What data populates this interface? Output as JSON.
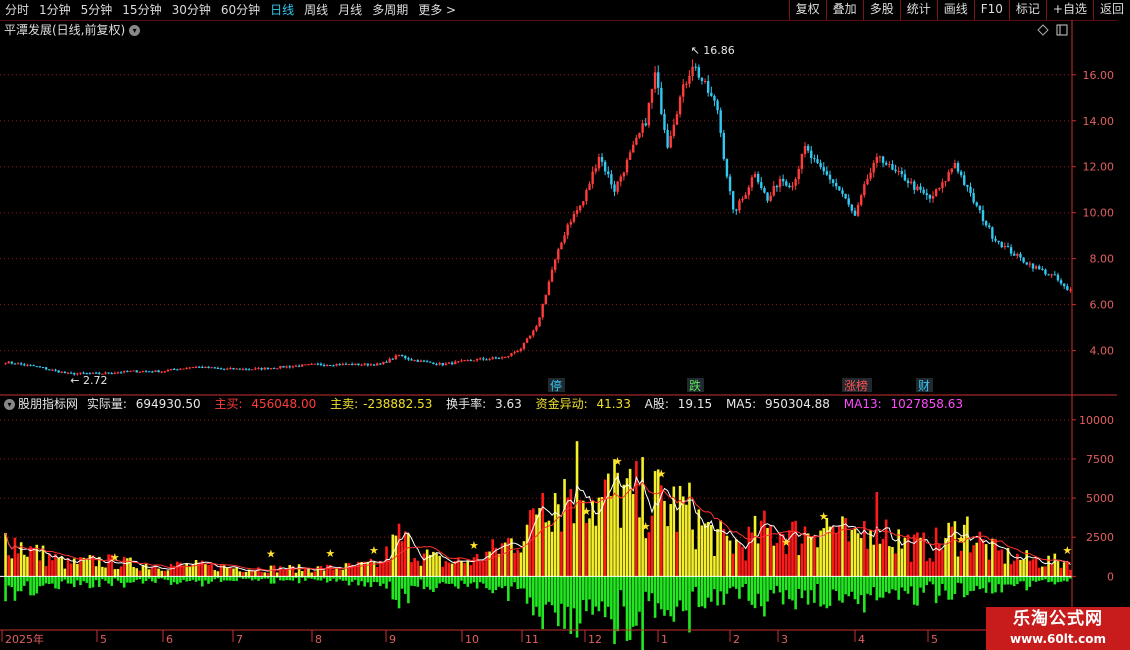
{
  "toolbar": {
    "periods": [
      "分时",
      "1分钟",
      "5分钟",
      "15分钟",
      "30分钟",
      "60分钟",
      "日线",
      "周线",
      "月线",
      "多周期",
      "更多"
    ],
    "active_period": "日线",
    "buttons": [
      "复权",
      "叠加",
      "多股",
      "统计",
      "画线",
      "F10",
      "标记",
      "+自选",
      "返回"
    ]
  },
  "chart_title": "平潭发展(日线,前复权)",
  "price_axis": {
    "ticks": [
      "16.00",
      "14.00",
      "12.00",
      "10.00",
      "8.00",
      "6.00",
      "4.00"
    ],
    "min": 2.2,
    "max": 17.6
  },
  "price_annotations": {
    "high": "16.86",
    "low": "2.72"
  },
  "event_labels": [
    {
      "text": "停",
      "color": "#33c8f0"
    },
    {
      "text": "跌",
      "color": "#5ce05c"
    },
    {
      "text": "涨榜",
      "color": "#ff5050"
    },
    {
      "text": "财",
      "color": "#33c8f0"
    }
  ],
  "indicator": {
    "name": "股朋指标网",
    "actual_label": "实际量:",
    "actual_value": "694930.50",
    "main_buy_label": "主买:",
    "main_buy_value": "456048.00",
    "main_sell_label": "主卖:",
    "main_sell_value": "-238882.53",
    "turnover_label": "换手率:",
    "turnover_value": "3.63",
    "fund_label": "资金异动:",
    "fund_value": "41.33",
    "ashare_label": "A股:",
    "ashare_value": "19.15",
    "ma5_label": "MA5:",
    "ma5_value": "950304.88",
    "ma13_label": "MA13:",
    "ma13_value": "1027858.63"
  },
  "volume_axis": {
    "ticks": [
      "10000",
      "7500",
      "5000",
      "2500",
      "0"
    ],
    "min": -3300,
    "max": 10500
  },
  "date_axis": {
    "ticks": [
      "2025年",
      "5",
      "6",
      "7",
      "8",
      "9",
      "10",
      "11",
      "12",
      "1",
      "2",
      "3",
      "4",
      "5"
    ]
  },
  "watermark": {
    "line1": "乐淘公式网",
    "line2": "www.60lt.com"
  },
  "colors": {
    "up": "#ff3c3c",
    "down": "#33c8f0",
    "grid": "#8b1a1a",
    "axis": "#c83030",
    "vol_yellow": "#f5f02a",
    "vol_red": "#ff1a1a",
    "vol_green": "#22e822",
    "ma_white": "#ffffff",
    "ma_red": "#ff3030",
    "star": "#ffe030"
  },
  "chart_data": {
    "type": "candlestick",
    "price_ylim": [
      2.2,
      17.6
    ],
    "volume_ylim": [
      -3300,
      10500
    ],
    "x_ticks": [
      "2025年",
      "5",
      "6",
      "7",
      "8",
      "9",
      "10",
      "11",
      "12",
      "1",
      "2",
      "3",
      "4",
      "5"
    ],
    "close_anchors": [
      [
        0,
        3.5
      ],
      [
        10,
        3.3
      ],
      [
        20,
        3.0
      ],
      [
        30,
        3.0
      ],
      [
        40,
        3.1
      ],
      [
        50,
        3.1
      ],
      [
        60,
        3.3
      ],
      [
        70,
        3.2
      ],
      [
        80,
        3.2
      ],
      [
        90,
        3.3
      ],
      [
        100,
        3.4
      ],
      [
        110,
        3.4
      ],
      [
        120,
        3.4
      ],
      [
        126,
        3.8
      ],
      [
        130,
        3.6
      ],
      [
        140,
        3.4
      ],
      [
        150,
        3.6
      ],
      [
        160,
        3.7
      ],
      [
        165,
        4.1
      ],
      [
        170,
        5.0
      ],
      [
        175,
        7.5
      ],
      [
        180,
        9.5
      ],
      [
        185,
        10.5
      ],
      [
        190,
        12.5
      ],
      [
        195,
        11.0
      ],
      [
        200,
        12.5
      ],
      [
        205,
        14.0
      ],
      [
        208,
        16.0
      ],
      [
        212,
        13.0
      ],
      [
        216,
        15.0
      ],
      [
        220,
        16.5
      ],
      [
        224,
        15.5
      ],
      [
        228,
        14.5
      ],
      [
        230,
        12.5
      ],
      [
        233,
        10.0
      ],
      [
        236,
        10.6
      ],
      [
        240,
        11.8
      ],
      [
        244,
        10.5
      ],
      [
        248,
        11.5
      ],
      [
        252,
        11.2
      ],
      [
        256,
        12.8
      ],
      [
        260,
        12.0
      ],
      [
        264,
        11.5
      ],
      [
        268,
        10.8
      ],
      [
        272,
        9.8
      ],
      [
        276,
        11.5
      ],
      [
        280,
        12.5
      ],
      [
        284,
        11.8
      ],
      [
        288,
        11.5
      ],
      [
        292,
        11.0
      ],
      [
        296,
        10.6
      ],
      [
        300,
        11.2
      ],
      [
        304,
        12.2
      ],
      [
        308,
        11.0
      ],
      [
        312,
        10.0
      ],
      [
        316,
        9.0
      ],
      [
        320,
        8.5
      ],
      [
        325,
        8.0
      ],
      [
        330,
        7.6
      ],
      [
        336,
        7.2
      ],
      [
        340,
        6.6
      ]
    ],
    "volume_anchors": [
      [
        0,
        2500
      ],
      [
        10,
        1500
      ],
      [
        20,
        800
      ],
      [
        30,
        1000
      ],
      [
        40,
        800
      ],
      [
        50,
        700
      ],
      [
        60,
        700
      ],
      [
        70,
        600
      ],
      [
        80,
        500
      ],
      [
        90,
        500
      ],
      [
        100,
        500
      ],
      [
        110,
        600
      ],
      [
        120,
        800
      ],
      [
        126,
        2500
      ],
      [
        132,
        1500
      ],
      [
        140,
        900
      ],
      [
        150,
        1000
      ],
      [
        160,
        2000
      ],
      [
        168,
        3000
      ],
      [
        172,
        6000
      ],
      [
        178,
        5200
      ],
      [
        184,
        6500
      ],
      [
        190,
        4500
      ],
      [
        196,
        5500
      ],
      [
        200,
        4800
      ],
      [
        206,
        5000
      ],
      [
        212,
        4500
      ],
      [
        218,
        4200
      ],
      [
        224,
        3000
      ],
      [
        230,
        2200
      ],
      [
        236,
        2000
      ],
      [
        242,
        2800
      ],
      [
        248,
        3000
      ],
      [
        254,
        2500
      ],
      [
        260,
        3500
      ],
      [
        266,
        3000
      ],
      [
        272,
        2000
      ],
      [
        278,
        4200
      ],
      [
        284,
        2500
      ],
      [
        290,
        2000
      ],
      [
        296,
        1800
      ],
      [
        302,
        2500
      ],
      [
        308,
        3000
      ],
      [
        314,
        1800
      ],
      [
        320,
        1300
      ],
      [
        330,
        1000
      ],
      [
        340,
        900
      ]
    ]
  }
}
